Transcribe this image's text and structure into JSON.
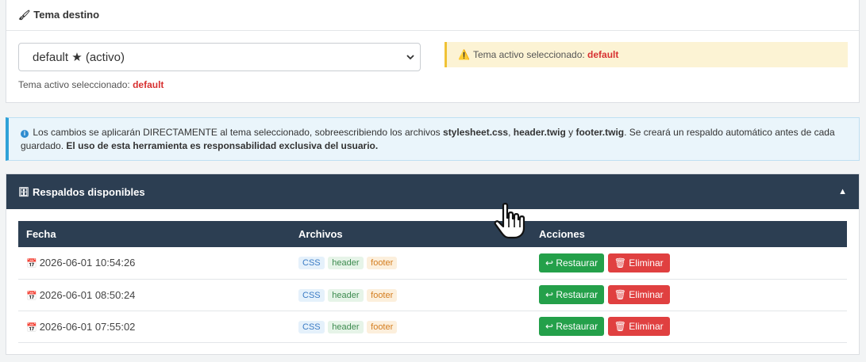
{
  "target_panel": {
    "title": "Tema destino",
    "select_value": "default ★ (activo)",
    "selected_label": "Tema activo seleccionado:",
    "selected_value": "default",
    "warning_label": "Tema activo seleccionado:",
    "warning_value": "default"
  },
  "info": {
    "p1": "Los cambios se aplicarán DIRECTAMENTE al tema seleccionado, sobreescribiendo los archivos ",
    "f1": "stylesheet.css",
    "sep1": ", ",
    "f2": "header.twig",
    "sep2": " y ",
    "f3": "footer.twig",
    "p2": ". Se creará un respaldo automático antes de cada guardado. ",
    "bold": "El uso de esta herramienta es responsabilidad exclusiva del usuario."
  },
  "backups": {
    "title": "Respaldos disponibles",
    "columns": [
      "Fecha",
      "Archivos",
      "Acciones"
    ],
    "rows": [
      {
        "date": "2026-06-01 10:54:26",
        "tags": [
          "CSS",
          "header",
          "footer"
        ],
        "restore": "↩ Restaurar",
        "delete": "Eliminar"
      },
      {
        "date": "2026-06-01 08:50:24",
        "tags": [
          "CSS",
          "header",
          "footer"
        ],
        "restore": "↩ Restaurar",
        "delete": "Eliminar"
      },
      {
        "date": "2026-06-01 07:55:02",
        "tags": [
          "CSS",
          "header",
          "footer"
        ],
        "restore": "↩ Restaurar",
        "delete": "Eliminar"
      }
    ]
  },
  "icons": {
    "brush": "paintbrush-icon",
    "warning": "warning-icon",
    "info": "info-icon",
    "archive": "archive-icon",
    "collapse": "caret-up-icon",
    "calendar": "calendar-icon",
    "trash": "trash-icon",
    "cursor": "hand-pointer-cursor"
  },
  "colors": {
    "header_dark": "#2c3e52",
    "danger": "#e04040",
    "success": "#24a04a",
    "warning_bg": "#fcf3d4",
    "info_bg": "#eaf5fb"
  }
}
